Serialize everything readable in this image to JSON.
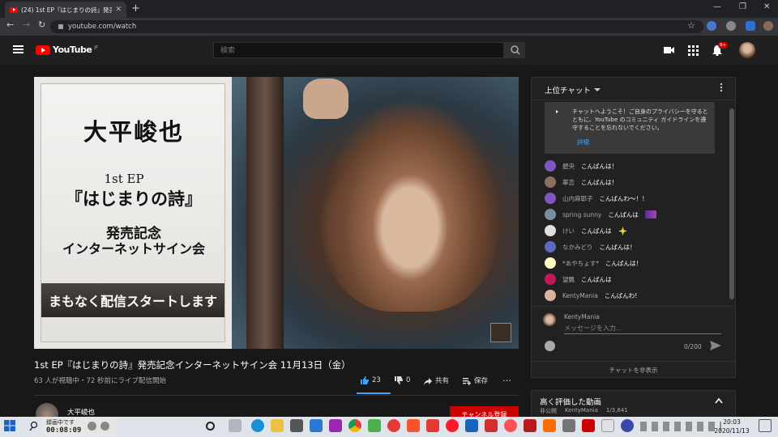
{
  "browser": {
    "tab_title": "(24) 1st EP『はじまりの詩』発売記念...",
    "tab_close": "✕",
    "new_tab": "+",
    "url": "youtube.com/watch",
    "back": "←",
    "forward": "→",
    "reload": "↻",
    "star": "☆",
    "win_min": "—",
    "win_max": "❐",
    "win_close": "✕"
  },
  "header": {
    "logo_text": "YouTube",
    "logo_region": "JP",
    "search_placeholder": "検索",
    "notification_count": "9+"
  },
  "video": {
    "overlay": {
      "name": "大平峻也",
      "ep": "1st EP",
      "title": "『はじまりの詩』",
      "release": "発売記念",
      "event": "インターネットサイン会",
      "banner": "まもなく配信スタートします"
    },
    "title": "1st EP『はじまりの詩』発売記念インターネットサイン会 11月13日（金）",
    "meta": "63 人が視聴中・72 秒前にライブ配信開始",
    "likes": "23",
    "dislikes": "0",
    "share_label": "共有",
    "save_label": "保存",
    "more": "…"
  },
  "channel": {
    "name": "大平峻也",
    "subscribe_label": "チャンネル登録"
  },
  "chat": {
    "mode_label": "上位チャット",
    "welcome_text": "チャットへようこそ！ご自身のプライバシーを守るとともに、YouTube のコミュニティ ガイドラインを遵守することを忘れないでください。",
    "welcome_link": "詳細",
    "messages": [
      {
        "author": "碧央",
        "text": "こんばんは！",
        "color": "#7e57c2"
      },
      {
        "author": "華恋",
        "text": "こんばんは！",
        "color": "#8d6e63"
      },
      {
        "author": "山内麻耶子",
        "text": "こんばんわ〜！！",
        "color": "#7e57c2"
      },
      {
        "author": "spring sunny",
        "text": "こんばんは",
        "color": "#78909c"
      },
      {
        "author": "けい",
        "text": "こんばんは",
        "color": "#e0e0e0"
      },
      {
        "author": "なかみどり",
        "text": "こんばんは！",
        "color": "#5c6bc0"
      },
      {
        "author": "*あやちょす*",
        "text": "こんばんは！",
        "color": "#fff9c4"
      },
      {
        "author": "望飄",
        "text": "こんばんは",
        "color": "#c2185b"
      },
      {
        "author": "KentyMania",
        "text": "こんばんわ!",
        "color": "#d7b49e"
      }
    ],
    "input_user": "KentyMania",
    "input_placeholder": "メッセージを入力...",
    "counter": "0/200",
    "hide_label": "チャットを非表示"
  },
  "rated": {
    "title": "高く評価した動画",
    "visibility": "非公開",
    "owner": "KentyMania",
    "position": "1/3,841"
  },
  "recording": {
    "label": "録画中です",
    "time": "00:08:09"
  },
  "taskbar": {
    "time": "20:03",
    "date": "2020/11/13"
  }
}
